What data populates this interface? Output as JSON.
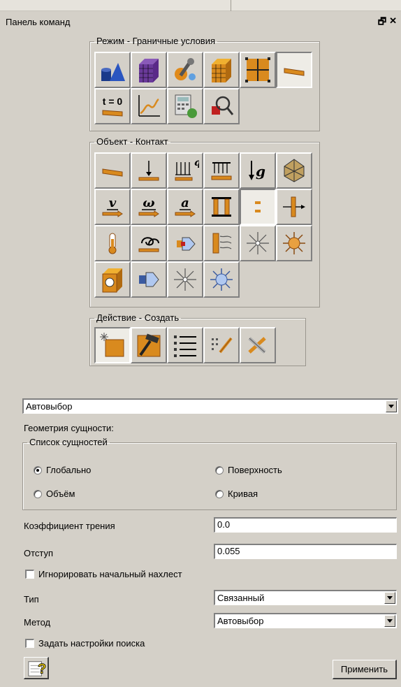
{
  "panel": {
    "title": "Панель команд",
    "float_icon": "restore-icon",
    "close_icon": "close-icon"
  },
  "mode_group": {
    "legend": "Режим - Граничные условия",
    "row1": [
      "geometry-icon",
      "mesh-icon",
      "properties-icon",
      "mesh-block-icon",
      "grid-icon",
      "boundary-conditions-icon"
    ],
    "row2_t0_label": "t = 0",
    "row2": [
      "initial-conditions-icon",
      "curve-icon",
      "calculator-icon",
      "inspect-icon"
    ]
  },
  "object_group": {
    "legend": "Объект - Контакт",
    "load_q_label": "q",
    "gravity_label": "g",
    "velocity_label": "v",
    "omega_label": "ω",
    "accel_label": "a"
  },
  "action_group": {
    "legend": "Действие - Создать"
  },
  "autoselect": {
    "value": "Автовыбор"
  },
  "entity_geometry_label": "Геометрия сущности:",
  "entity_list": {
    "legend": "Список сущностей",
    "options": [
      "Глобально",
      "Поверхность",
      "Объём",
      "Кривая"
    ],
    "selected": "Глобально"
  },
  "friction": {
    "label": "Коэффициент трения",
    "value": "0.0"
  },
  "offset": {
    "label": "Отступ",
    "value": "0.055"
  },
  "ignore_overlap": {
    "label": "Игнорировать начальный нахлест",
    "checked": false
  },
  "type": {
    "label": "Тип",
    "value": "Связанный"
  },
  "method": {
    "label": "Метод",
    "value": "Автовыбор"
  },
  "search_settings": {
    "label": "Задать настройки поиска",
    "checked": false
  },
  "help_icon": "help-icon",
  "apply_label": "Применить",
  "colors": {
    "background": "#d4d0c8",
    "accent": "#d98a1e",
    "dark_accent": "#8a4a10"
  }
}
